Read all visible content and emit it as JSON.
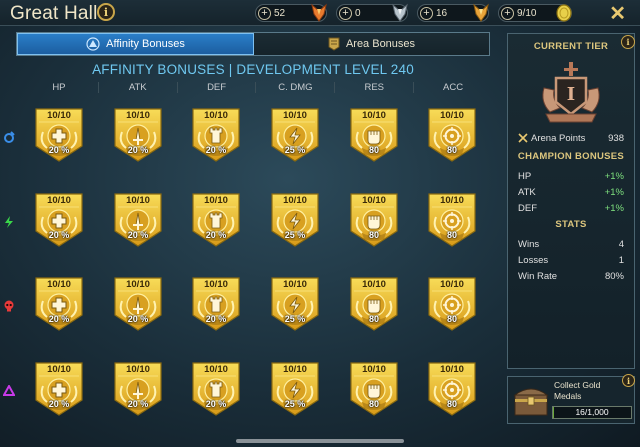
{
  "window": {
    "title": "Great Hall"
  },
  "resources": [
    {
      "name": "energy",
      "value": "52",
      "icon": "energy-icon",
      "color": "#e87b2e"
    },
    {
      "name": "arena-tokens",
      "value": "0",
      "icon": "silver-token-icon",
      "color": "#b8c4cc"
    },
    {
      "name": "gold-tokens",
      "value": "16",
      "icon": "gold-token-icon",
      "color": "#e8a43a"
    },
    {
      "name": "keys",
      "value": "9/10",
      "icon": "coin-icon",
      "color": "#e8d04a"
    }
  ],
  "tabs": [
    {
      "label": "Affinity Bonuses",
      "active": true
    },
    {
      "label": "Area Bonuses",
      "active": false
    }
  ],
  "heading": "AFFINITY BONUSES | DEVELOPMENT LEVEL 240",
  "columns": [
    "HP",
    "ATK",
    "DEF",
    "C. DMG",
    "RES",
    "ACC"
  ],
  "affinities": [
    {
      "name": "magic",
      "icon": "magic-affinity-icon",
      "color": "#3a8ee8",
      "bonuses": [
        {
          "level": "10/10",
          "value": "20 %"
        },
        {
          "level": "10/10",
          "value": "20 %"
        },
        {
          "level": "10/10",
          "value": "20 %"
        },
        {
          "level": "10/10",
          "value": "25 %"
        },
        {
          "level": "10/10",
          "value": "80"
        },
        {
          "level": "10/10",
          "value": "80"
        }
      ]
    },
    {
      "name": "force",
      "icon": "force-affinity-icon",
      "color": "#3ad84a",
      "bonuses": [
        {
          "level": "10/10",
          "value": "20 %"
        },
        {
          "level": "10/10",
          "value": "20 %"
        },
        {
          "level": "10/10",
          "value": "20 %"
        },
        {
          "level": "10/10",
          "value": "25 %"
        },
        {
          "level": "10/10",
          "value": "80"
        },
        {
          "level": "10/10",
          "value": "80"
        }
      ]
    },
    {
      "name": "spirit",
      "icon": "spirit-affinity-icon",
      "color": "#e83a3a",
      "bonuses": [
        {
          "level": "10/10",
          "value": "20 %"
        },
        {
          "level": "10/10",
          "value": "20 %"
        },
        {
          "level": "10/10",
          "value": "20 %"
        },
        {
          "level": "10/10",
          "value": "25 %"
        },
        {
          "level": "10/10",
          "value": "80"
        },
        {
          "level": "10/10",
          "value": "80"
        }
      ]
    },
    {
      "name": "void",
      "icon": "void-affinity-icon",
      "color": "#c83ae8",
      "bonuses": [
        {
          "level": "10/10",
          "value": "20 %"
        },
        {
          "level": "10/10",
          "value": "20 %"
        },
        {
          "level": "10/10",
          "value": "20 %"
        },
        {
          "level": "10/10",
          "value": "25 %"
        },
        {
          "level": "10/10",
          "value": "80"
        },
        {
          "level": "10/10",
          "value": "80"
        }
      ]
    }
  ],
  "stat_icons": [
    "hp-cross-icon",
    "sword-icon",
    "tower-icon",
    "lightning-icon",
    "fist-icon",
    "target-icon"
  ],
  "sidebar": {
    "tier_title": "CURRENT TIER",
    "tier_numeral": "I",
    "arena_points_label": "Arena Points",
    "arena_points_value": "938",
    "champion_title": "CHAMPION BONUSES",
    "champion_bonuses": [
      {
        "label": "HP",
        "value": "+1%"
      },
      {
        "label": "ATK",
        "value": "+1%"
      },
      {
        "label": "DEF",
        "value": "+1%"
      }
    ],
    "stats_title": "STATS",
    "stats": [
      {
        "label": "Wins",
        "value": "4"
      },
      {
        "label": "Losses",
        "value": "1"
      },
      {
        "label": "Win Rate",
        "value": "80%"
      }
    ]
  },
  "quest": {
    "text_line1": "Collect Gold",
    "text_line2": "Medals",
    "progress_text": "16/1,000",
    "progress_fraction": 0.016
  },
  "colors": {
    "accent": "#2a7ec8",
    "heading": "#6fc8f0",
    "gold": "#e8b82a"
  }
}
